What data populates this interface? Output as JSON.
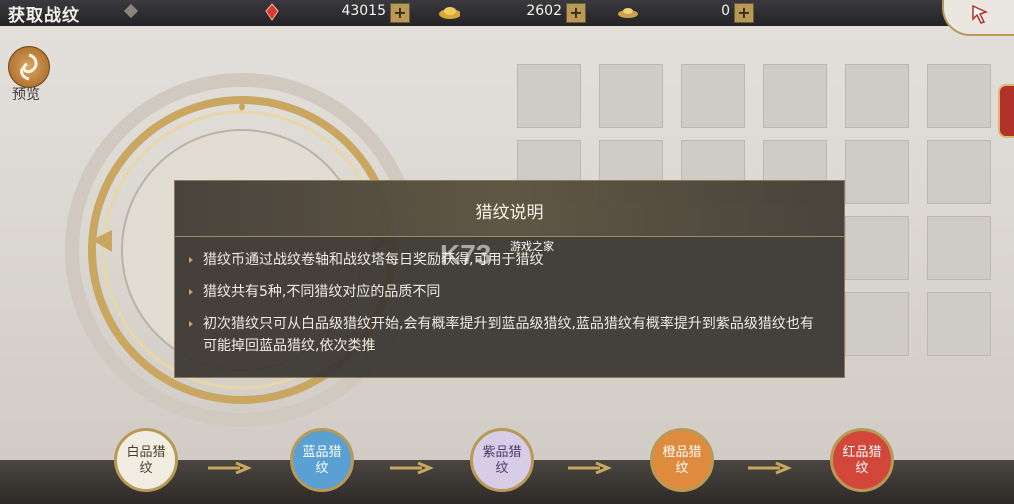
{
  "header": {
    "title": "获取战纹",
    "currencies": [
      {
        "icon": "red-gem-icon",
        "value": "43015",
        "plus": "+"
      },
      {
        "icon": "gold-ingot-icon",
        "value": "2602",
        "plus": "+"
      },
      {
        "icon": "small-ingot-icon",
        "value": "0",
        "plus": "+"
      }
    ],
    "back_icon": "back-arrow-icon"
  },
  "sidebar": {
    "preview_label": "预览",
    "preview_icon": "swirl-icon"
  },
  "dialog": {
    "title": "猎纹说明",
    "tips": [
      "猎纹币通过战纹卷轴和战纹塔每日奖励获得,可用于猎纹",
      "猎纹共有5种,不同猎纹对应的品质不同",
      "初次猎纹只可从白品级猎纹开始,会有概率提升到蓝品级猎纹,蓝品猎纹有概率提升到紫品级猎纹也有可能掉回蓝品猎纹,依次类推"
    ]
  },
  "watermark": {
    "logo": "K73",
    "text": "游戏之家"
  },
  "grades": [
    {
      "label": "白品猎纹",
      "color": "#f2ede2",
      "text_color": "#4a4030"
    },
    {
      "label": "蓝品猎纹",
      "color": "#5aa0d2",
      "text_color": "#ffffff"
    },
    {
      "label": "紫品猎纹",
      "color": "#d8cde6",
      "text_color": "#4a3a6a"
    },
    {
      "label": "橙品猎纹",
      "color": "#e08a3e",
      "text_color": "#ffffff"
    },
    {
      "label": "红品猎纹",
      "color": "#d2473a",
      "text_color": "#ffffff"
    }
  ],
  "colors": {
    "accent_gold": "#b89a56",
    "dialog_bg": "#3a3632"
  }
}
